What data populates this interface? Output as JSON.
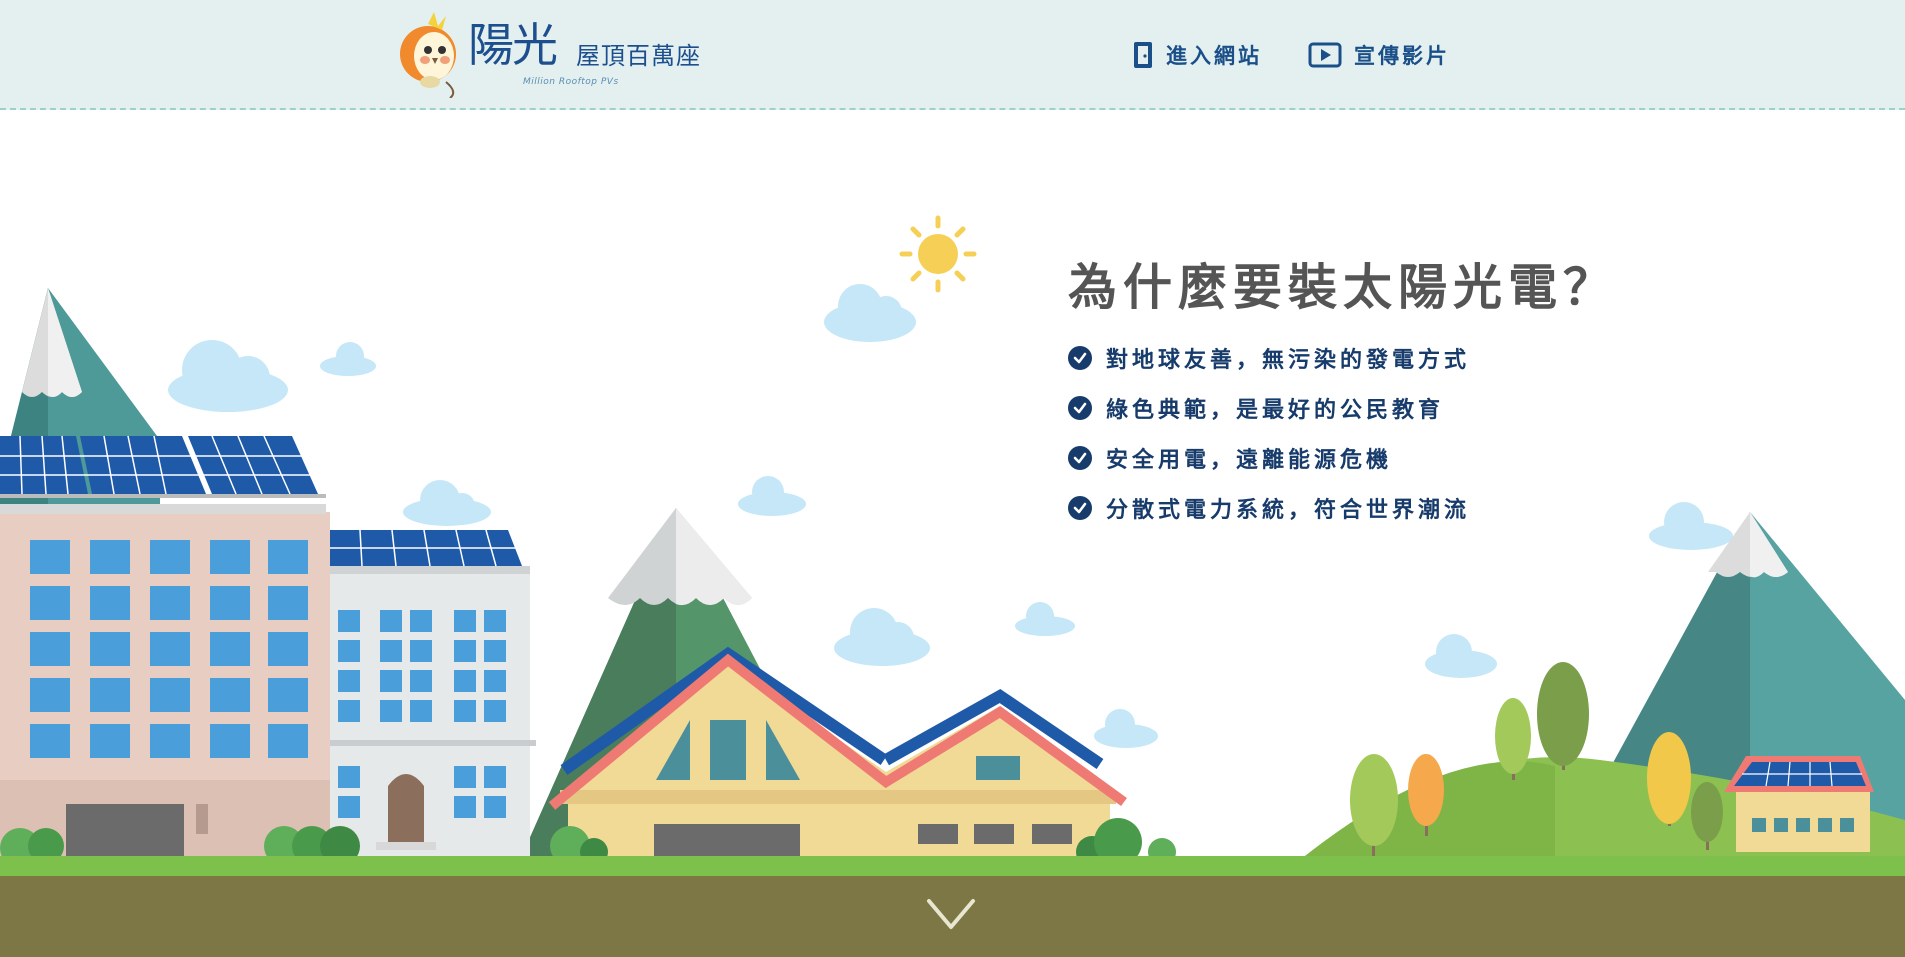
{
  "header": {
    "logo": {
      "title_main": "陽光",
      "title_sub": "屋頂百萬座",
      "title_en": "Million Rooftop PVs"
    },
    "nav": [
      {
        "label": "進入網站",
        "icon": "door-icon"
      },
      {
        "label": "宣傳影片",
        "icon": "play-video-icon"
      }
    ]
  },
  "hero": {
    "headline": "為什麼要裝太陽光電？",
    "features": [
      "對地球友善，無污染的發電方式",
      "綠色典範，是最好的公民教育",
      "安全用電，遠離能源危機",
      "分散式電力系統，符合世界潮流"
    ],
    "scroll_icon": "chevron-down-icon"
  },
  "colors": {
    "header_bg": "#e3f0ef",
    "brand_blue": "#1a4f8a",
    "headline_gray": "#555555",
    "grass": "#7dc04b",
    "soil": "#7d7745"
  }
}
